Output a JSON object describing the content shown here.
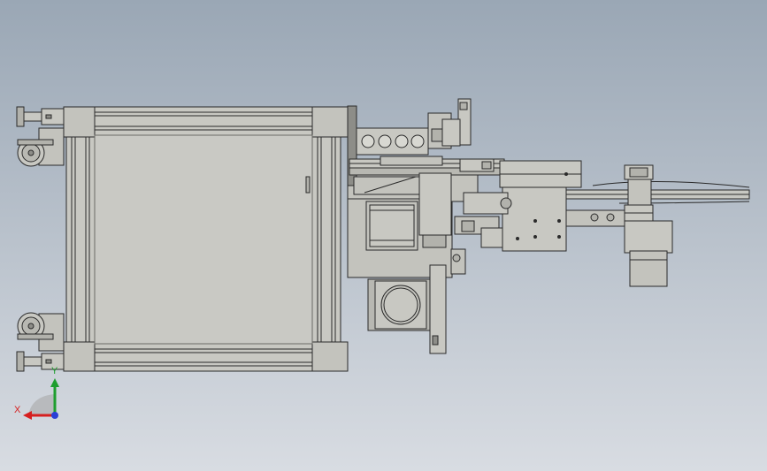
{
  "viewport": {
    "background_top": "#9aa7b5",
    "background_bottom": "#d8dce2"
  },
  "model": {
    "fill_light": "#c8c8c2",
    "fill_mid": "#b2b2ac",
    "fill_dark": "#8d8d88",
    "edge_color": "#2a2a2a"
  },
  "triad": {
    "x_label": "X",
    "y_label": "Y",
    "x_color": "#d61f1f",
    "y_color": "#1e9e2e",
    "z_color": "#2a3fd6"
  }
}
